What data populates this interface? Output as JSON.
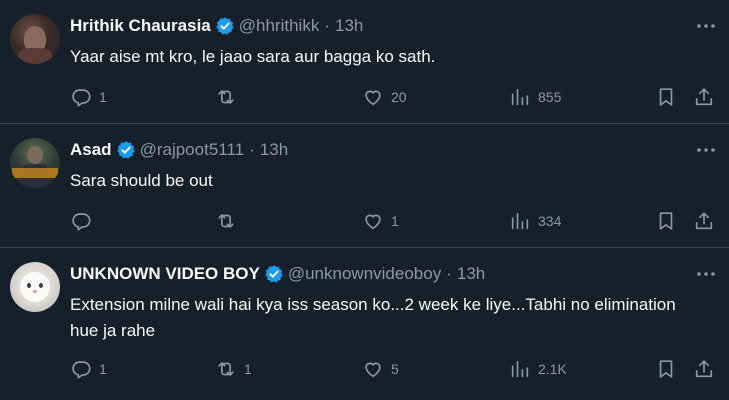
{
  "tweets": [
    {
      "name": "Hrithik Chaurasia",
      "handle": "@hhrithikk",
      "separator": "·",
      "time": "13h",
      "text": "Yaar aise mt kro, le jaao sara aur bagga ko sath.",
      "replies": "1",
      "retweets": "",
      "likes": "20",
      "views": "855"
    },
    {
      "name": "Asad",
      "handle": "@rajpoot5111",
      "separator": "·",
      "time": "13h",
      "text": "Sara should be out",
      "replies": "",
      "retweets": "",
      "likes": "1",
      "views": "334"
    },
    {
      "name": "UNKNOWN VIDEO BOY",
      "handle": "@unknownvideoboy",
      "separator": "·",
      "time": "13h",
      "text": "Extension milne wali hai kya iss season ko...2 week ke liye...Tabhi no elimination hue ja rahe",
      "replies": "1",
      "retweets": "1",
      "likes": "5",
      "views": "2.1K"
    }
  ],
  "icons": {
    "verified": "verified-badge-icon",
    "more": "more-options-icon",
    "reply": "reply-icon",
    "retweet": "retweet-icon",
    "like": "heart-icon",
    "views": "views-chart-icon",
    "bookmark": "bookmark-icon",
    "share": "share-icon"
  },
  "colors": {
    "background": "#15202b",
    "text": "#f7f9f9",
    "muted": "#8b98a5",
    "divider": "#38444d",
    "verified": "#1d9bf0"
  }
}
